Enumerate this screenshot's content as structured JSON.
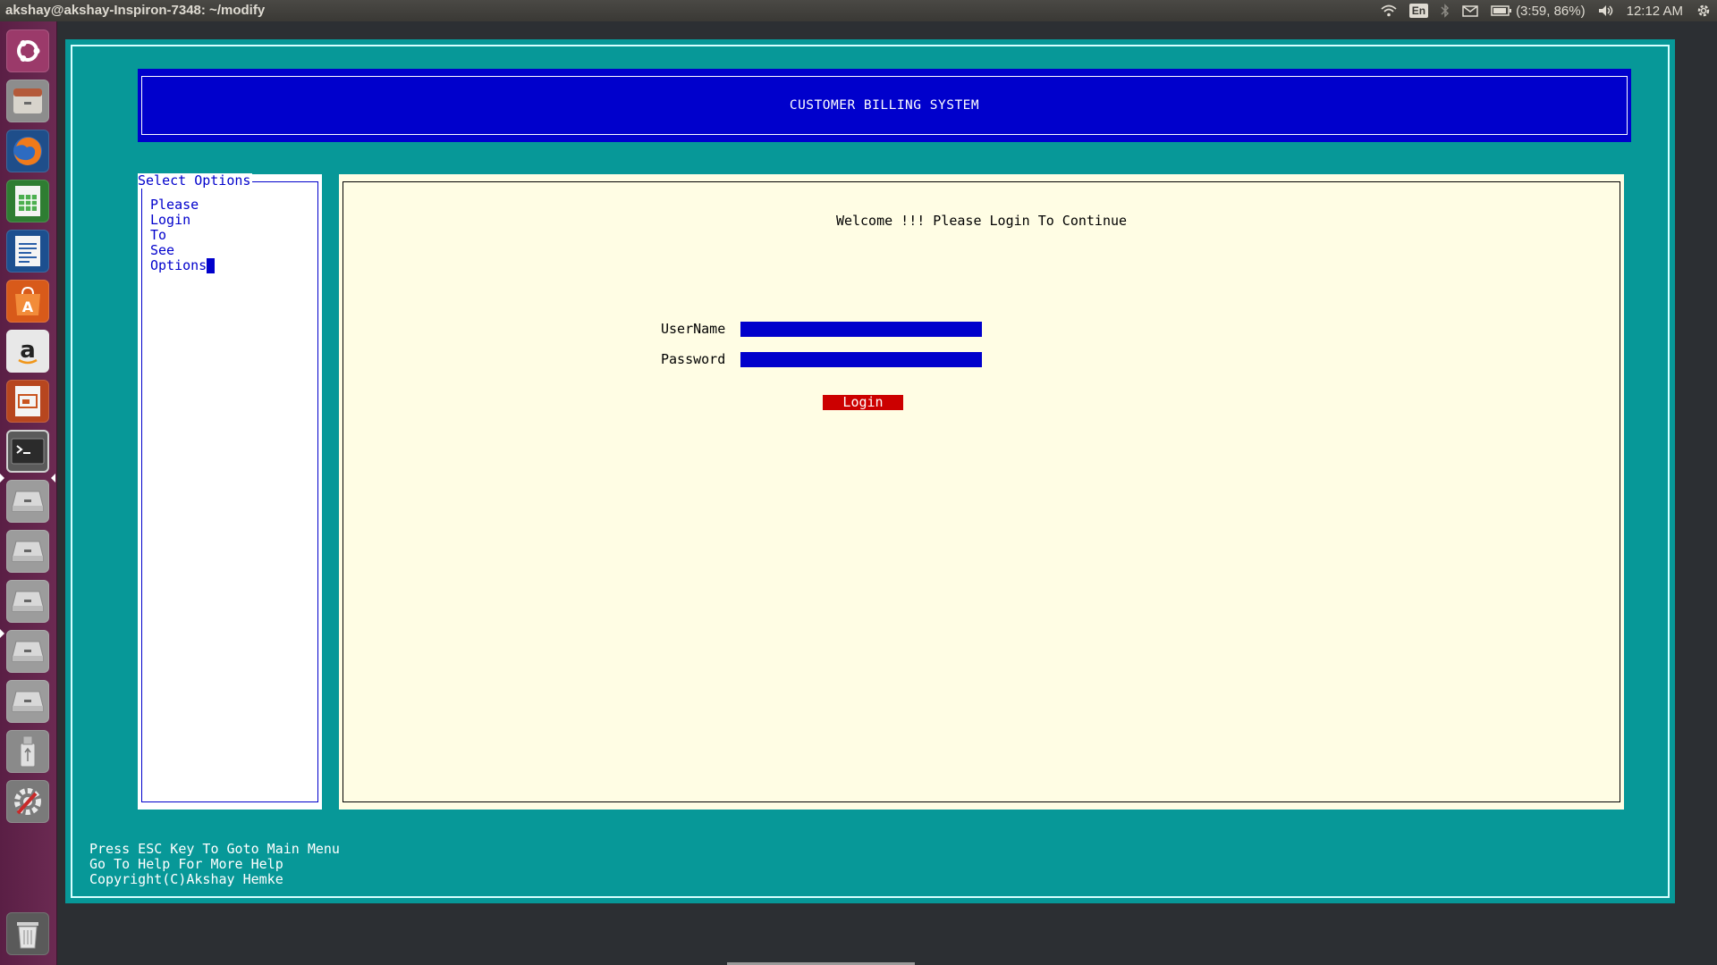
{
  "top_panel": {
    "window_title": "akshay@akshay-Inspiron-7348: ~/modify",
    "keyboard_layout": "En",
    "battery_text": "(3:59, 86%)",
    "clock": "12:12 AM",
    "icons": [
      "wifi-icon",
      "keyboard-icon",
      "bluetooth-icon",
      "mail-icon",
      "battery-icon",
      "volume-icon",
      "gear-icon"
    ]
  },
  "launcher": {
    "items": [
      "ubuntu-dash-icon",
      "files-icon",
      "firefox-icon",
      "spreadsheet-icon",
      "writer-icon",
      "software-center-icon",
      "amazon-icon",
      "impress-icon",
      "terminal-icon",
      "drive-icon",
      "drive-icon",
      "drive-icon",
      "drive-icon",
      "drive-icon",
      "usb-icon",
      "system-settings-icon",
      "trash-icon"
    ]
  },
  "app": {
    "header_title": "CUSTOMER BILLING SYSTEM",
    "options_title": "Select Options",
    "options_lines": [
      "Please",
      "Login",
      "To",
      "See",
      "Options"
    ],
    "welcome_text": "Welcome !!! Please Login To Continue",
    "username_label": "UserName",
    "password_label": "Password",
    "username_value": "",
    "password_value": "",
    "login_label": "Login",
    "footer_lines": [
      "Press ESC Key To Goto Main Menu",
      "Go To Help For More Help",
      "Copyright(C)Akshay Hemke"
    ]
  },
  "colors": {
    "background": "#079898",
    "header": "#0000cc",
    "panel": "#fffde4",
    "button": "#cc0000"
  }
}
